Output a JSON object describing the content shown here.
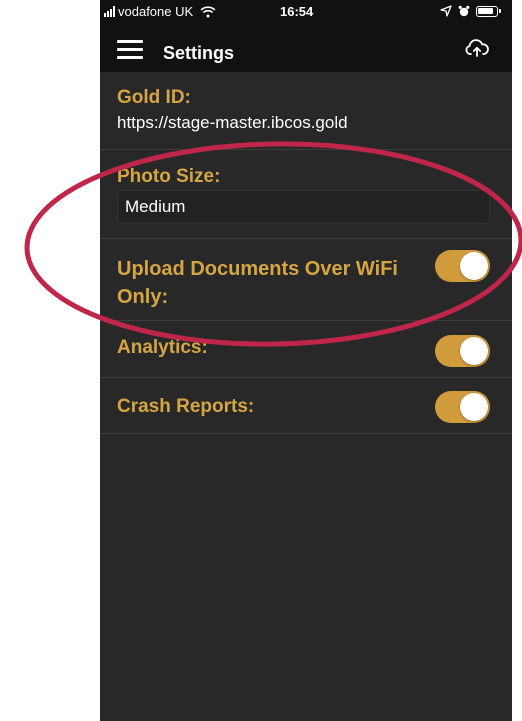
{
  "status_bar": {
    "carrier": "vodafone UK",
    "time": "16:54"
  },
  "navbar": {
    "title": "Settings"
  },
  "settings": {
    "gold_id": {
      "label": "Gold ID:",
      "value": "https://stage-master.ibcos.gold"
    },
    "photo_size": {
      "label": "Photo Size:",
      "value": "Medium"
    },
    "upload_wifi_only": {
      "label": "Upload Documents Over WiFi Only:",
      "enabled": true
    },
    "analytics": {
      "label": "Analytics:",
      "enabled": true
    },
    "crash_reports": {
      "label": "Crash Reports:",
      "enabled": true
    }
  },
  "colors": {
    "accent_gold": "#d5a541",
    "toggle_on": "#d09b3b",
    "background": "#282828",
    "annotation_ring": "#c0254a"
  }
}
